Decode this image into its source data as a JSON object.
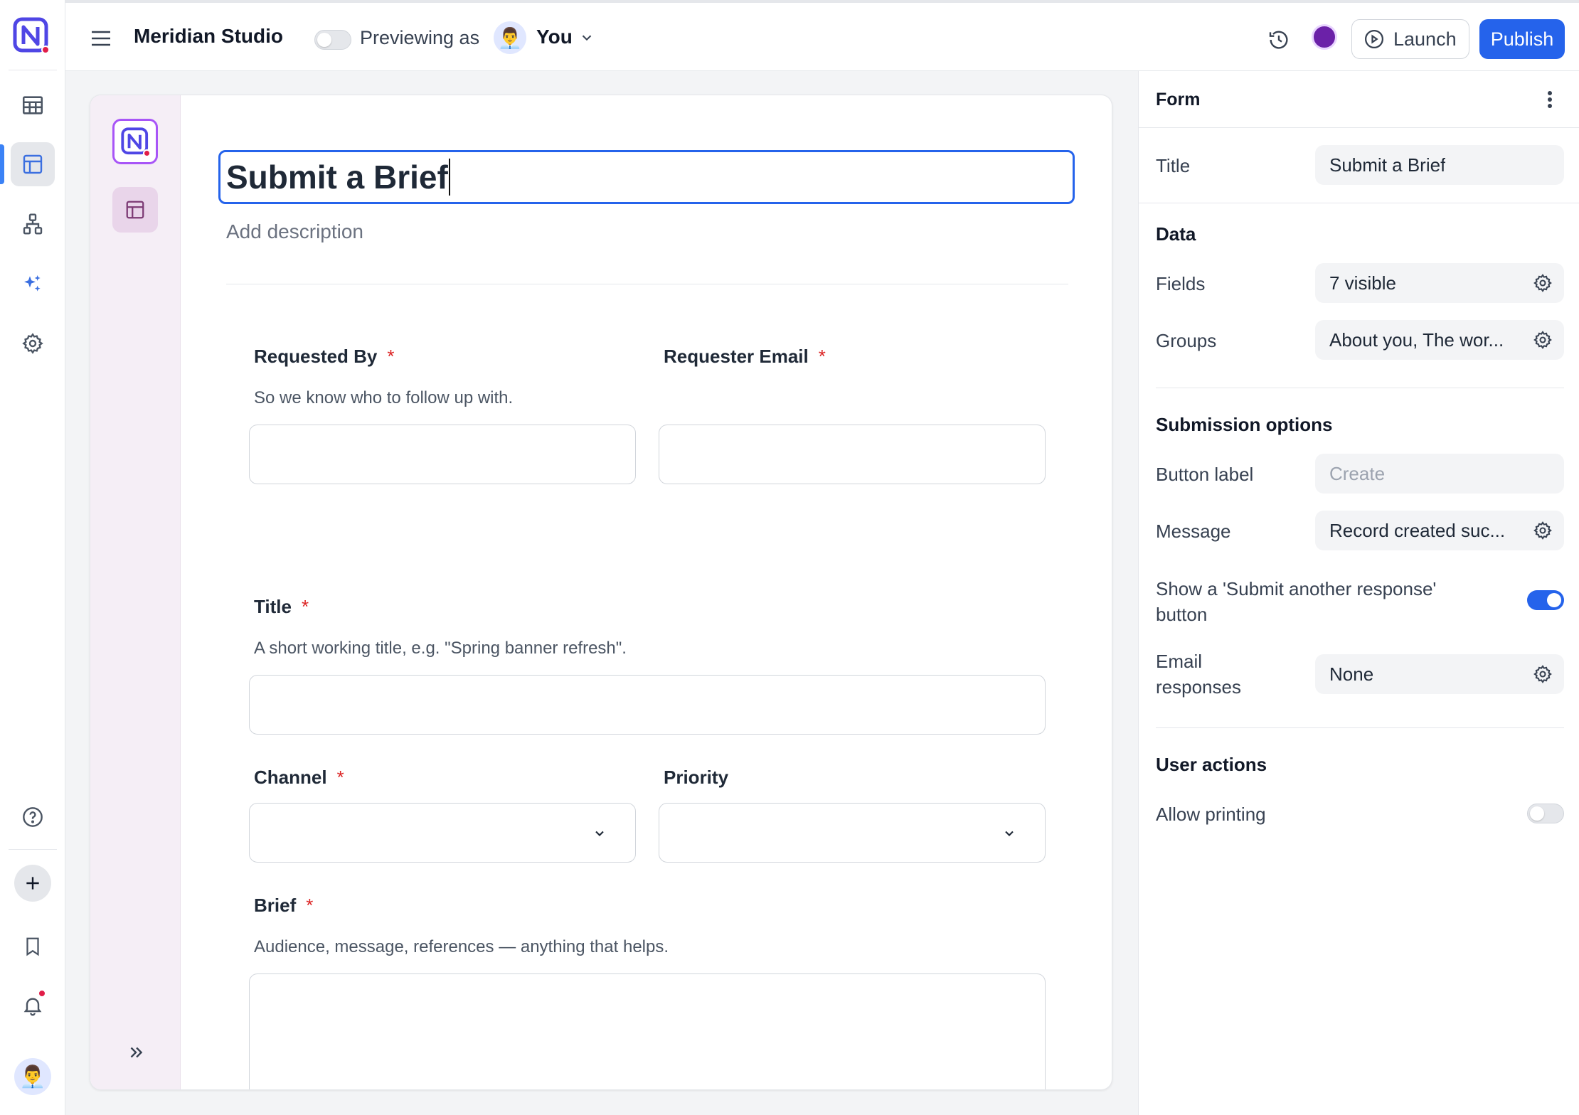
{
  "app": {
    "name": "Meridian Studio",
    "preview_label": "Previewing as",
    "preview_user": "You",
    "preview_avatar": "👨‍💼",
    "accent": "#2563eb",
    "theme_color": "#6b21a8"
  },
  "toolbar": {
    "launch_label": "Launch",
    "publish_label": "Publish"
  },
  "rail": {
    "items": [
      {
        "icon": "table-icon",
        "active": false
      },
      {
        "icon": "layout-icon",
        "active": true
      },
      {
        "icon": "workflow-icon",
        "active": false
      },
      {
        "icon": "sparkles-icon",
        "active": false
      },
      {
        "icon": "gear-icon",
        "active": false
      }
    ],
    "bottom": [
      "help-icon",
      "plus-icon",
      "bookmark-icon",
      "bell-icon"
    ],
    "user_avatar": "👨‍💼"
  },
  "form": {
    "title": "Submit a Brief",
    "description_placeholder": "Add description",
    "fields": [
      {
        "label": "Requested By",
        "required": "*",
        "help": "So we know who to follow up with."
      },
      {
        "label": "Requester Email",
        "required": "*",
        "help": ""
      },
      {
        "label": "Title",
        "required": "*",
        "help": "A short working title, e.g. \"Spring banner refresh\"."
      },
      {
        "label": "Channel",
        "required": "*",
        "help": ""
      },
      {
        "label": "Priority",
        "required": "",
        "help": ""
      },
      {
        "label": "Brief",
        "required": "*",
        "help": "Audience, message, references — anything that helps."
      }
    ]
  },
  "panel": {
    "header": "Form",
    "title_label": "Title",
    "title_value": "Submit a Brief",
    "data_section": "Data",
    "fields_label": "Fields",
    "fields_value": "7 visible",
    "groups_label": "Groups",
    "groups_value": "About you, The wor...",
    "submission_section": "Submission options",
    "button_label_label": "Button label",
    "button_label_placeholder": "Create",
    "message_label": "Message",
    "message_value": "Record created suc...",
    "another_response_label": "Show a 'Submit another response' button",
    "another_response_on": true,
    "email_label": "Email responses",
    "email_value": "None",
    "user_actions_section": "User actions",
    "printing_label": "Allow printing",
    "printing_on": false
  }
}
